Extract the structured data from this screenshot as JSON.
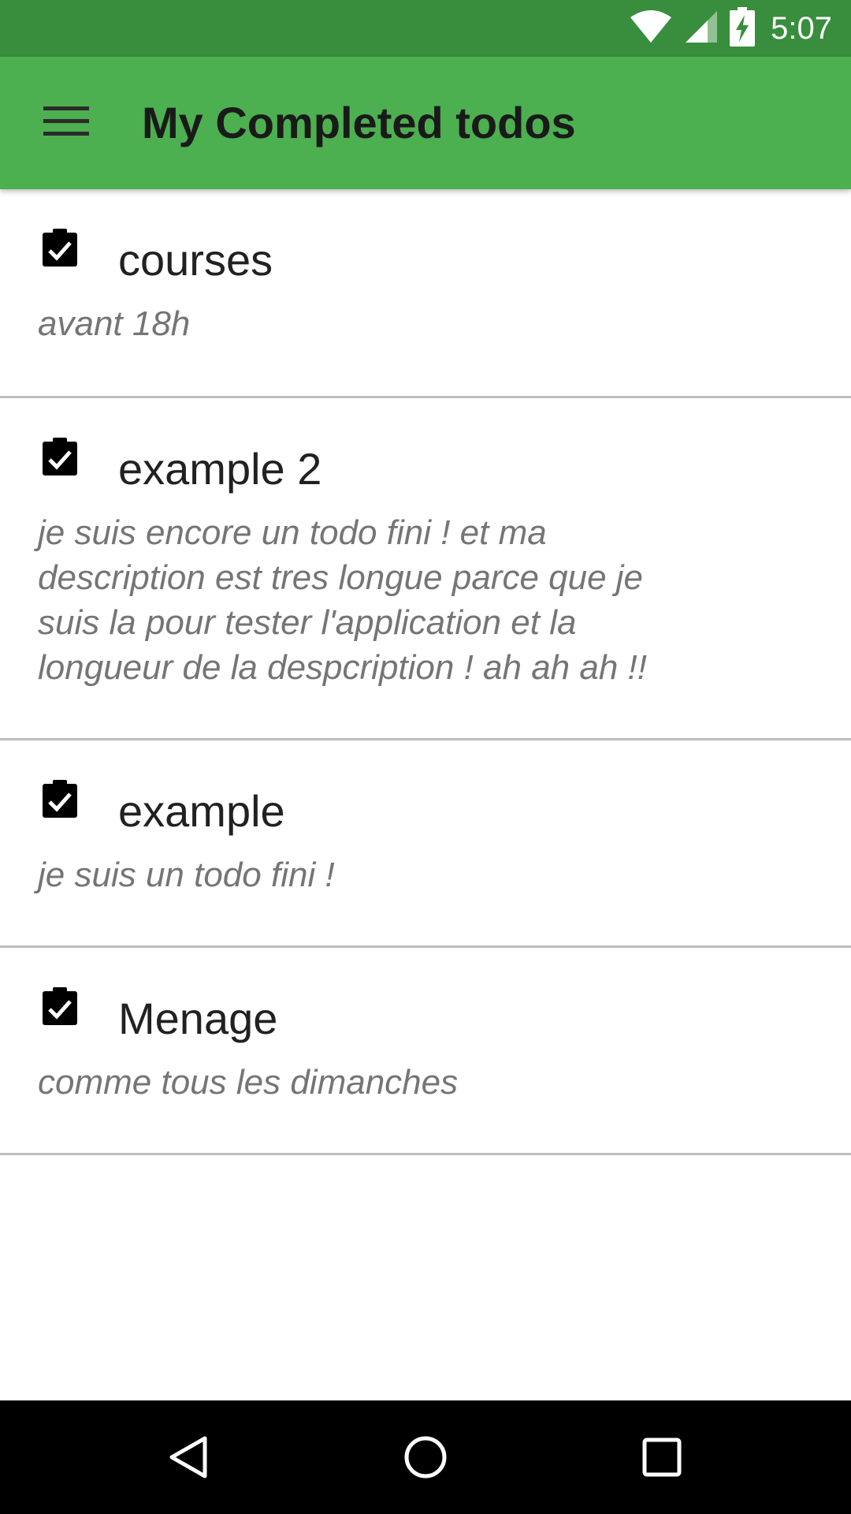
{
  "status_bar": {
    "time": "5:07",
    "icons": [
      "wifi-icon",
      "signal-icon",
      "battery-charging-icon"
    ]
  },
  "app_bar": {
    "title": "My Completed todos",
    "menu_icon": "hamburger-menu-icon",
    "background": "#4caf50",
    "status_background": "#388e3c"
  },
  "todos": [
    {
      "title": "courses",
      "description": "avant 18h"
    },
    {
      "title": "example 2",
      "description": "je suis encore un todo fini ! et ma description est tres longue parce que je suis la pour tester l'application et la longueur de la despcription ! ah ah ah !!"
    },
    {
      "title": "example",
      "description": "je suis un todo fini !"
    },
    {
      "title": "Menage",
      "description": "comme tous les dimanches"
    }
  ],
  "nav_bar": {
    "icons": [
      "back-icon",
      "home-icon",
      "recents-icon"
    ]
  }
}
